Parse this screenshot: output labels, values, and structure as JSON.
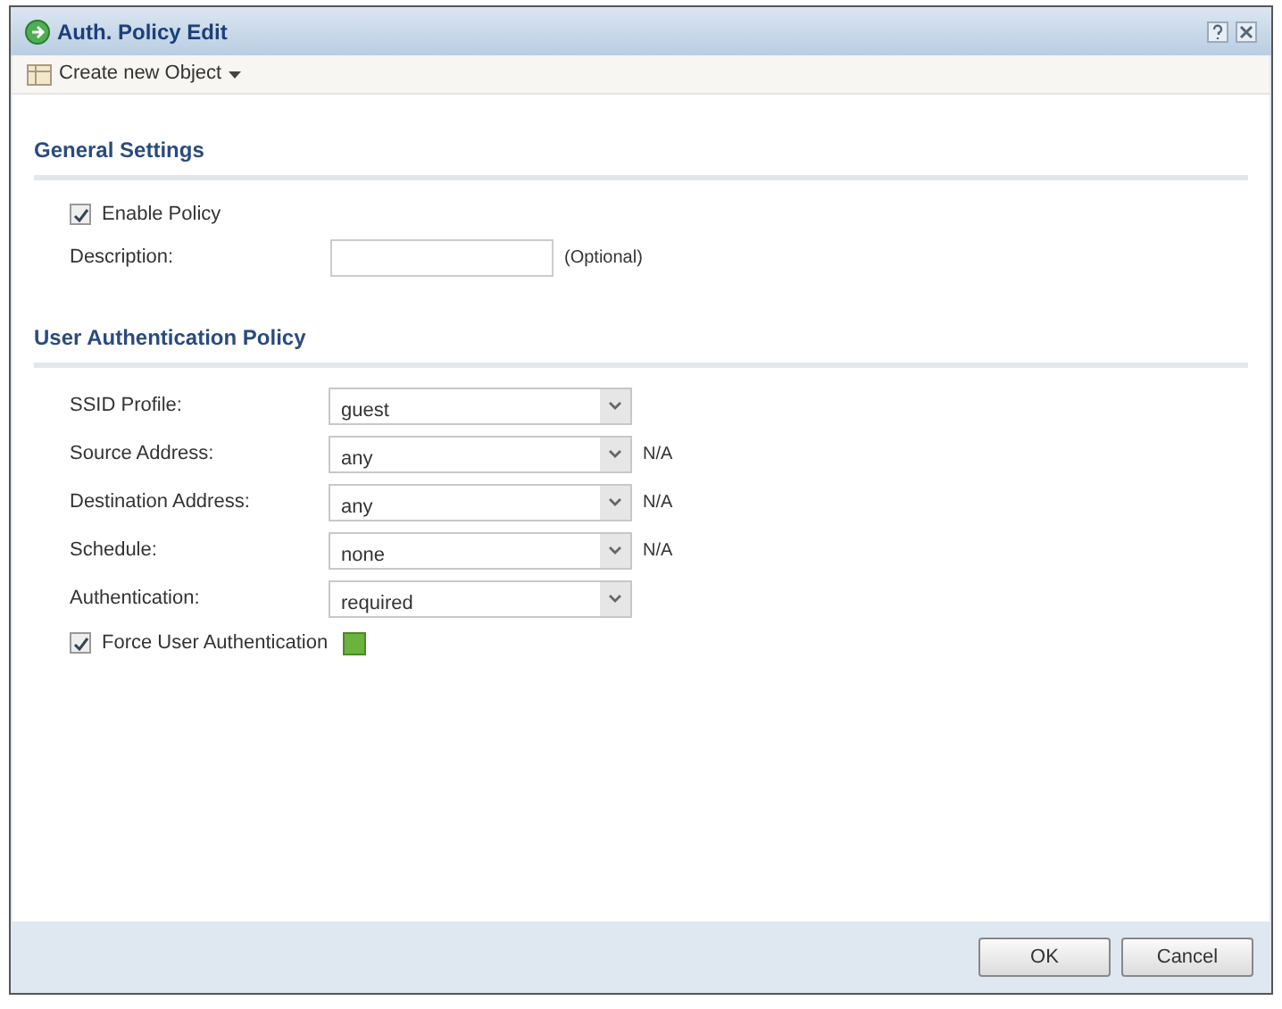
{
  "window": {
    "title": "Auth. Policy Edit"
  },
  "toolbar": {
    "menu_label": "Create new Object"
  },
  "sections": [
    {
      "title": "General Settings",
      "fields": [
        {
          "kind": "checkbox",
          "label": "Enable Policy",
          "checked": true
        },
        {
          "kind": "text",
          "label": "Description:",
          "note": "(Optional)"
        }
      ]
    },
    {
      "title": "User Authentication Policy",
      "fields": [
        {
          "kind": "select",
          "label": "SSID Profile:",
          "value": "guest"
        },
        {
          "kind": "select",
          "label": "Source Address:",
          "value": "any",
          "note": "N/A"
        },
        {
          "kind": "select",
          "label": "Destination Address:",
          "value": "any",
          "note": "N/A"
        },
        {
          "kind": "select",
          "label": "Schedule:",
          "value": "none",
          "note": "N/A"
        },
        {
          "kind": "select",
          "label": "Authentication:",
          "value": "required"
        },
        {
          "kind": "checkbox",
          "label": "Force User Authentication",
          "checked": true,
          "info": true
        }
      ]
    }
  ],
  "buttons": [
    "OK",
    "Cancel"
  ]
}
